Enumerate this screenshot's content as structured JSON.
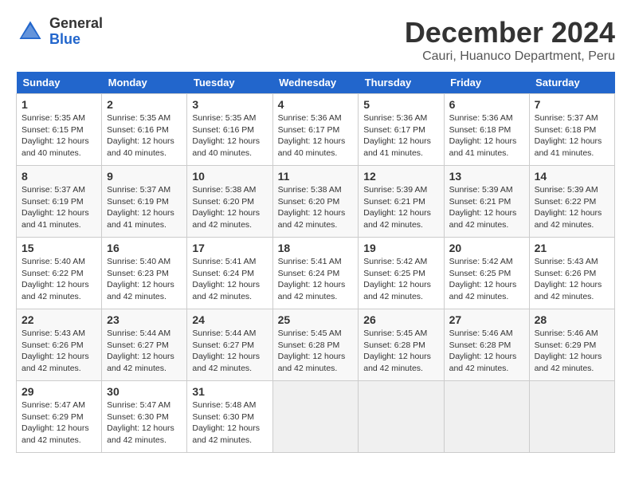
{
  "header": {
    "logo_general": "General",
    "logo_blue": "Blue",
    "title": "December 2024",
    "location": "Cauri, Huanuco Department, Peru"
  },
  "calendar": {
    "days_of_week": [
      "Sunday",
      "Monday",
      "Tuesday",
      "Wednesday",
      "Thursday",
      "Friday",
      "Saturday"
    ],
    "weeks": [
      [
        {
          "day": "",
          "info": ""
        },
        {
          "day": "2",
          "info": "Sunrise: 5:35 AM\nSunset: 6:16 PM\nDaylight: 12 hours\nand 40 minutes."
        },
        {
          "day": "3",
          "info": "Sunrise: 5:35 AM\nSunset: 6:16 PM\nDaylight: 12 hours\nand 40 minutes."
        },
        {
          "day": "4",
          "info": "Sunrise: 5:36 AM\nSunset: 6:17 PM\nDaylight: 12 hours\nand 40 minutes."
        },
        {
          "day": "5",
          "info": "Sunrise: 5:36 AM\nSunset: 6:17 PM\nDaylight: 12 hours\nand 41 minutes."
        },
        {
          "day": "6",
          "info": "Sunrise: 5:36 AM\nSunset: 6:18 PM\nDaylight: 12 hours\nand 41 minutes."
        },
        {
          "day": "7",
          "info": "Sunrise: 5:37 AM\nSunset: 6:18 PM\nDaylight: 12 hours\nand 41 minutes."
        }
      ],
      [
        {
          "day": "8",
          "info": "Sunrise: 5:37 AM\nSunset: 6:19 PM\nDaylight: 12 hours\nand 41 minutes."
        },
        {
          "day": "9",
          "info": "Sunrise: 5:37 AM\nSunset: 6:19 PM\nDaylight: 12 hours\nand 41 minutes."
        },
        {
          "day": "10",
          "info": "Sunrise: 5:38 AM\nSunset: 6:20 PM\nDaylight: 12 hours\nand 42 minutes."
        },
        {
          "day": "11",
          "info": "Sunrise: 5:38 AM\nSunset: 6:20 PM\nDaylight: 12 hours\nand 42 minutes."
        },
        {
          "day": "12",
          "info": "Sunrise: 5:39 AM\nSunset: 6:21 PM\nDaylight: 12 hours\nand 42 minutes."
        },
        {
          "day": "13",
          "info": "Sunrise: 5:39 AM\nSunset: 6:21 PM\nDaylight: 12 hours\nand 42 minutes."
        },
        {
          "day": "14",
          "info": "Sunrise: 5:39 AM\nSunset: 6:22 PM\nDaylight: 12 hours\nand 42 minutes."
        }
      ],
      [
        {
          "day": "15",
          "info": "Sunrise: 5:40 AM\nSunset: 6:22 PM\nDaylight: 12 hours\nand 42 minutes."
        },
        {
          "day": "16",
          "info": "Sunrise: 5:40 AM\nSunset: 6:23 PM\nDaylight: 12 hours\nand 42 minutes."
        },
        {
          "day": "17",
          "info": "Sunrise: 5:41 AM\nSunset: 6:24 PM\nDaylight: 12 hours\nand 42 minutes."
        },
        {
          "day": "18",
          "info": "Sunrise: 5:41 AM\nSunset: 6:24 PM\nDaylight: 12 hours\nand 42 minutes."
        },
        {
          "day": "19",
          "info": "Sunrise: 5:42 AM\nSunset: 6:25 PM\nDaylight: 12 hours\nand 42 minutes."
        },
        {
          "day": "20",
          "info": "Sunrise: 5:42 AM\nSunset: 6:25 PM\nDaylight: 12 hours\nand 42 minutes."
        },
        {
          "day": "21",
          "info": "Sunrise: 5:43 AM\nSunset: 6:26 PM\nDaylight: 12 hours\nand 42 minutes."
        }
      ],
      [
        {
          "day": "22",
          "info": "Sunrise: 5:43 AM\nSunset: 6:26 PM\nDaylight: 12 hours\nand 42 minutes."
        },
        {
          "day": "23",
          "info": "Sunrise: 5:44 AM\nSunset: 6:27 PM\nDaylight: 12 hours\nand 42 minutes."
        },
        {
          "day": "24",
          "info": "Sunrise: 5:44 AM\nSunset: 6:27 PM\nDaylight: 12 hours\nand 42 minutes."
        },
        {
          "day": "25",
          "info": "Sunrise: 5:45 AM\nSunset: 6:28 PM\nDaylight: 12 hours\nand 42 minutes."
        },
        {
          "day": "26",
          "info": "Sunrise: 5:45 AM\nSunset: 6:28 PM\nDaylight: 12 hours\nand 42 minutes."
        },
        {
          "day": "27",
          "info": "Sunrise: 5:46 AM\nSunset: 6:28 PM\nDaylight: 12 hours\nand 42 minutes."
        },
        {
          "day": "28",
          "info": "Sunrise: 5:46 AM\nSunset: 6:29 PM\nDaylight: 12 hours\nand 42 minutes."
        }
      ],
      [
        {
          "day": "29",
          "info": "Sunrise: 5:47 AM\nSunset: 6:29 PM\nDaylight: 12 hours\nand 42 minutes."
        },
        {
          "day": "30",
          "info": "Sunrise: 5:47 AM\nSunset: 6:30 PM\nDaylight: 12 hours\nand 42 minutes."
        },
        {
          "day": "31",
          "info": "Sunrise: 5:48 AM\nSunset: 6:30 PM\nDaylight: 12 hours\nand 42 minutes."
        },
        {
          "day": "",
          "info": ""
        },
        {
          "day": "",
          "info": ""
        },
        {
          "day": "",
          "info": ""
        },
        {
          "day": "",
          "info": ""
        }
      ]
    ],
    "week1_day1": {
      "day": "1",
      "info": "Sunrise: 5:35 AM\nSunset: 6:15 PM\nDaylight: 12 hours\nand 40 minutes."
    }
  }
}
